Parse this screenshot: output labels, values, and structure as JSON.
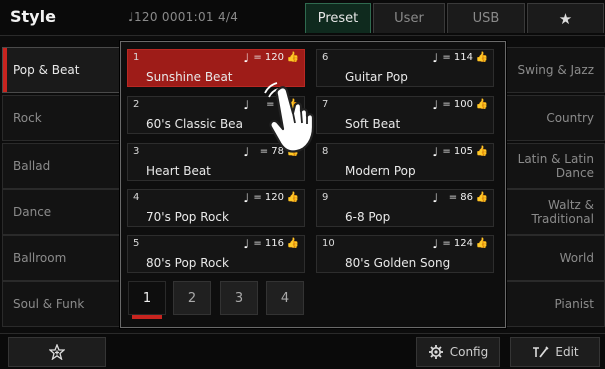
{
  "header": {
    "title": "Style",
    "status": "♩120  0001:01  4/4",
    "tabs": [
      {
        "label": "Preset",
        "active": true
      },
      {
        "label": "User",
        "active": false
      },
      {
        "label": "USB",
        "active": false
      },
      {
        "label": "★",
        "icon": "star-icon",
        "active": false
      }
    ]
  },
  "left_categories": [
    {
      "label": "Pop & Beat",
      "selected": true
    },
    {
      "label": "Rock",
      "selected": false
    },
    {
      "label": "Ballad",
      "selected": false
    },
    {
      "label": "Dance",
      "selected": false
    },
    {
      "label": "Ballroom",
      "selected": false
    },
    {
      "label": "Soul & Funk",
      "selected": false
    }
  ],
  "right_categories": [
    {
      "label": "Swing & Jazz"
    },
    {
      "label": "Country"
    },
    {
      "label": "Latin & Latin Dance"
    },
    {
      "label": "Waltz & Traditional"
    },
    {
      "label": "World"
    },
    {
      "label": "Pianist"
    }
  ],
  "styles": [
    {
      "num": "1",
      "tempo": "= 120",
      "name": "Sunshine Beat",
      "selected": true
    },
    {
      "num": "2",
      "tempo": "= 1",
      "name": "60's Classic Bea",
      "selected": false
    },
    {
      "num": "3",
      "tempo": "= 78",
      "name": "Heart Beat",
      "selected": false
    },
    {
      "num": "4",
      "tempo": "= 120",
      "name": "70's Pop Rock",
      "selected": false
    },
    {
      "num": "5",
      "tempo": "= 116",
      "name": "80's Pop Rock",
      "selected": false
    },
    {
      "num": "6",
      "tempo": "= 114",
      "name": "Guitar Pop",
      "selected": false
    },
    {
      "num": "7",
      "tempo": "= 100",
      "name": "Soft Beat",
      "selected": false
    },
    {
      "num": "8",
      "tempo": "= 105",
      "name": "Modern Pop",
      "selected": false
    },
    {
      "num": "9",
      "tempo": "= 86",
      "name": "6-8 Pop",
      "selected": false
    },
    {
      "num": "10",
      "tempo": "= 124",
      "name": "80's Golden Song",
      "selected": false
    }
  ],
  "pages": [
    {
      "label": "1",
      "active": true
    },
    {
      "label": "2",
      "active": false
    },
    {
      "label": "3",
      "active": false
    },
    {
      "label": "4",
      "active": false
    }
  ],
  "bottom": {
    "favorite_icon": "star-add-icon",
    "config_label": "Config",
    "edit_label": "Edit"
  },
  "colors": {
    "accent_red": "#c8241f",
    "selected_cell": "#9e1c18",
    "active_tab": "#0f2a1e"
  }
}
